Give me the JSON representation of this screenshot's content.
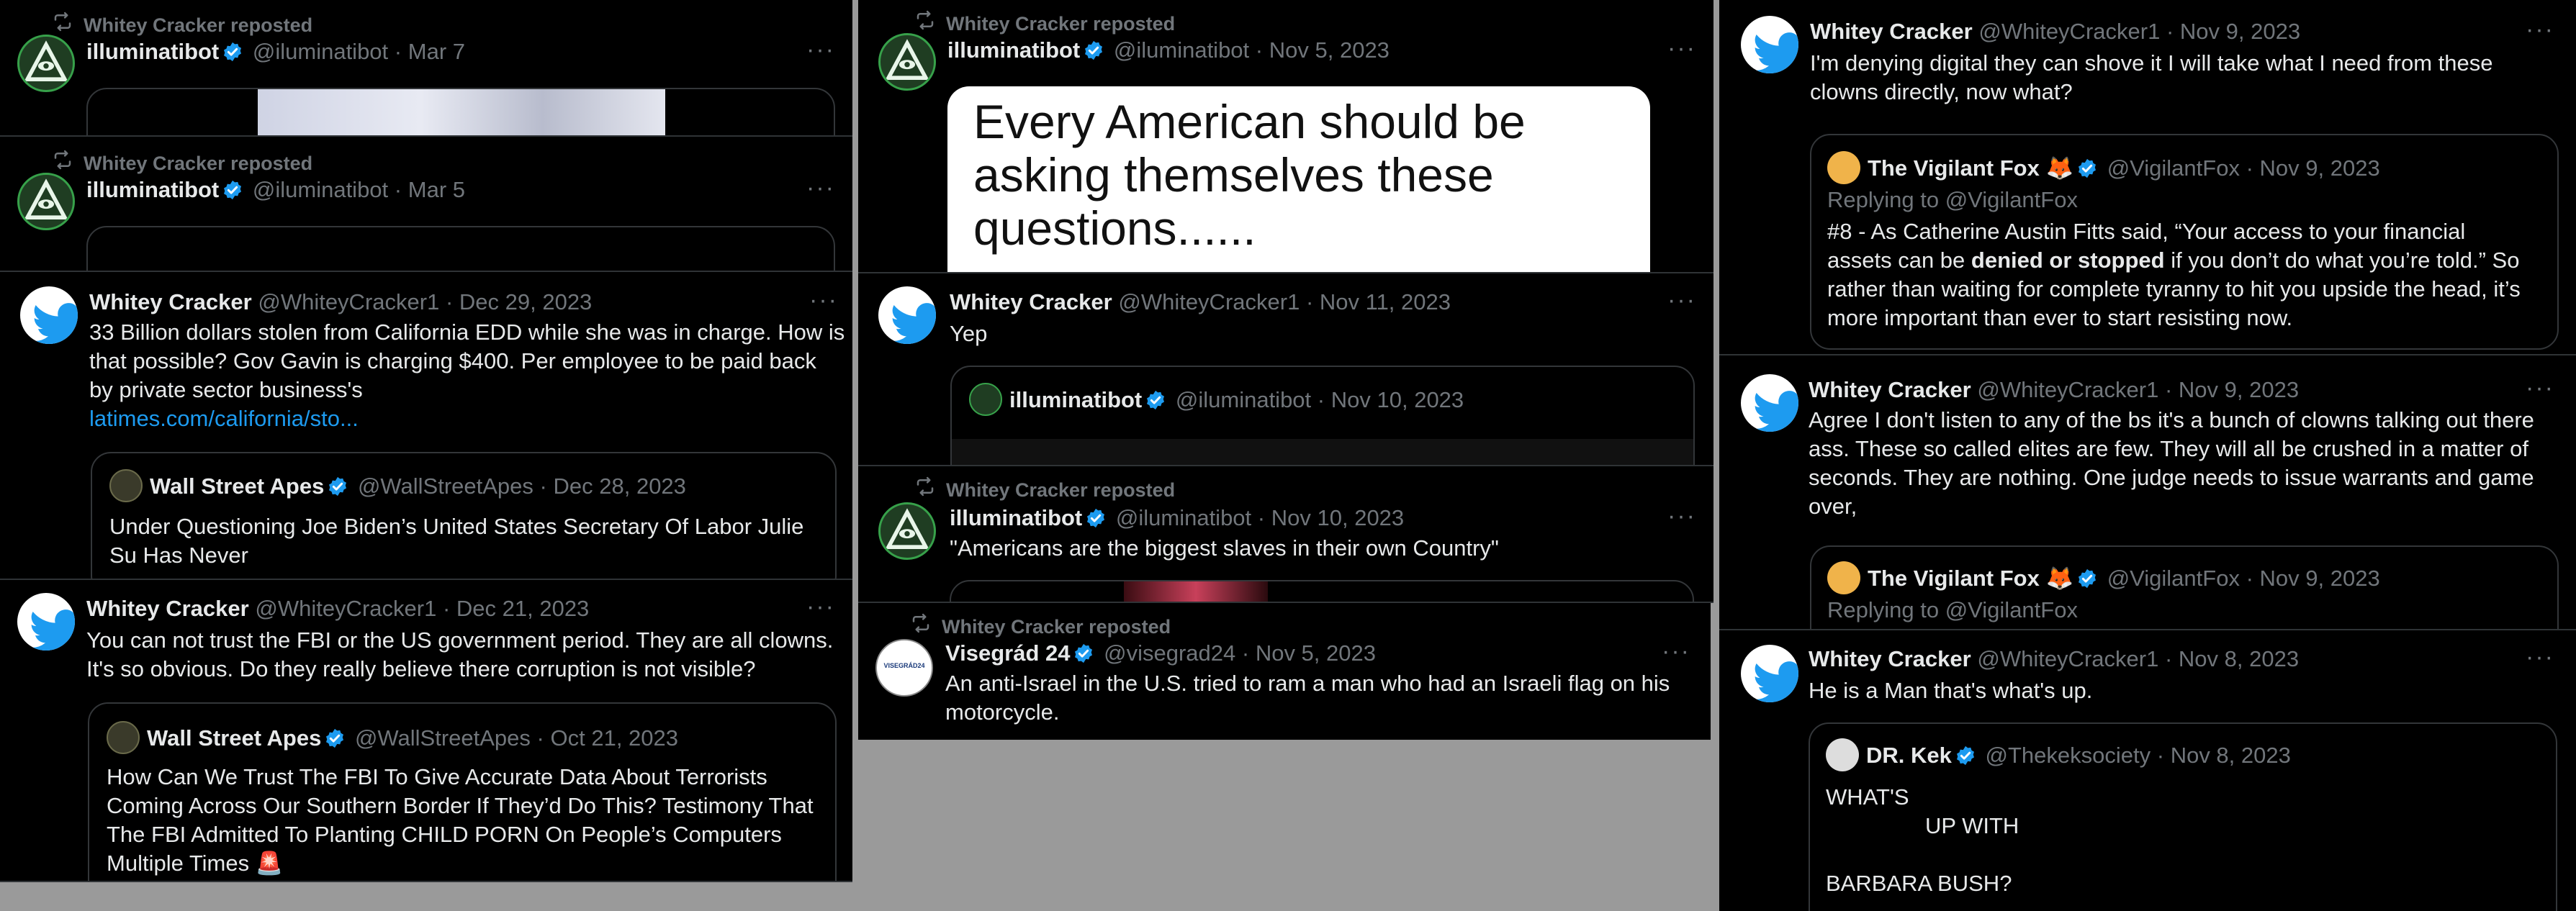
{
  "colors": {
    "accent": "#1d9bf0",
    "muted": "#71767b",
    "bg": "#000000",
    "text": "#e7e9ea"
  },
  "icons": {
    "repost": "repost-icon",
    "verified": "verified-badge-icon",
    "more": "more-options-icon"
  },
  "repost_label": "Whitey Cracker reposted",
  "more_label": "···",
  "dot": "·",
  "p1": {
    "name": "illuminatibot",
    "handle": "@iluminatibot",
    "date": "Mar 7"
  },
  "p2": {
    "name": "illuminatibot",
    "handle": "@iluminatibot",
    "date": "Mar 5"
  },
  "p3": {
    "name": "Whitey Cracker",
    "handle": "@WhiteyCracker1",
    "date": "Dec 29, 2023",
    "lines": [
      "33 Billion dollars stolen from California EDD while she was in charge. How is",
      "that possible? Gov Gavin is charging $400. Per employee to be paid back",
      "by private sector business's"
    ],
    "link": "latimes.com/california/sto...",
    "quote": {
      "name": "Wall Street Apes",
      "handle": "@WallStreetApes",
      "date": "Dec 28, 2023",
      "lines": [
        "Under Questioning Joe Biden’s United States Secretary Of Labor Julie",
        "Su Has Never"
      ]
    }
  },
  "p4": {
    "name": "Whitey Cracker",
    "handle": "@WhiteyCracker1",
    "date": "Dec 21, 2023",
    "lines": [
      "You can not trust the FBI or the US government period. They are all clowns.",
      "It's so obvious. Do they really believe there corruption is not visible?"
    ],
    "quote": {
      "name": "Wall Street Apes",
      "handle": "@WallStreetApes",
      "date": "Oct 21, 2023",
      "lines": [
        "How Can We Trust The FBI To Give Accurate Data About Terrorists",
        "Coming Across Our Southern Border If They’d Do This? Testimony That",
        "The FBI Admitted To Planting CHILD PORN On People’s Computers",
        "Multiple Times 🚨"
      ]
    }
  },
  "p5": {
    "name": "illuminatibot",
    "handle": "@iluminatibot",
    "date": "Nov 5, 2023",
    "image_lines": [
      "Every American should be",
      "asking themselves these",
      "questions......"
    ]
  },
  "p6": {
    "name": "Whitey Cracker",
    "handle": "@WhiteyCracker1",
    "date": "Nov 11, 2023",
    "text": "Yep",
    "quote": {
      "name": "illuminatibot",
      "handle": "@iluminatibot",
      "date": "Nov 10, 2023"
    }
  },
  "p7": {
    "name": "illuminatibot",
    "handle": "@iluminatibot",
    "date": "Nov 10, 2023",
    "text": "\"Americans are the biggest slaves in their own Country\""
  },
  "p8": {
    "name": "Visegrád 24",
    "handle": "@visegrad24",
    "date": "Nov 5, 2023",
    "avatar_text": "VISEGRÁD24",
    "lines": [
      "An anti-Israel in the U.S. tried to ram a man who had an Israeli flag on his",
      "motorcycle."
    ]
  },
  "p9": {
    "name": "Whitey Cracker",
    "handle": "@WhiteyCracker1",
    "date": "Nov 9, 2023",
    "lines": [
      "I'm denying digital they can shove it I will take what I need from these",
      "clowns directly, now what?"
    ],
    "quote": {
      "name": "The Vigilant Fox 🦊",
      "handle": "@VigilantFox",
      "date": "Nov 9, 2023",
      "replying": "Replying to @VigilantFox",
      "l1": "#8 - As Catherine Austin Fitts said, “Your access to your financial",
      "l2a": "assets can be ",
      "l2b": "denied or stopped",
      "l2c": " if you don’t do what you’re told.” So",
      "l3": "rather than waiting for complete tyranny to hit you upside the head, it’s",
      "l4": "more important than ever to start resisting now."
    }
  },
  "p10": {
    "name": "Whitey Cracker",
    "handle": "@WhiteyCracker1",
    "date": "Nov 9, 2023",
    "lines": [
      "Agree I don't listen  to any of the bs it's a bunch of clowns talking out there",
      "ass. These so called elites are few. They will all be crushed in a matter of",
      "seconds. They are nothing. One judge needs to issue warrants and game",
      "over,"
    ],
    "quote": {
      "name": "The Vigilant Fox 🦊",
      "handle": "@VigilantFox",
      "date": "Nov 9, 2023",
      "replying": "Replying to @VigilantFox"
    }
  },
  "p11": {
    "name": "Whitey Cracker",
    "handle": "@WhiteyCracker1",
    "date": "Nov 8, 2023",
    "text": "He is a Man that's what's up.",
    "quote": {
      "name": "DR. Kek",
      "handle": "@Thekeksociety",
      "date": "Nov 8, 2023",
      "lines": [
        "WHAT'S",
        "UP WITH",
        "",
        "BARBARA BUSH?"
      ]
    }
  }
}
